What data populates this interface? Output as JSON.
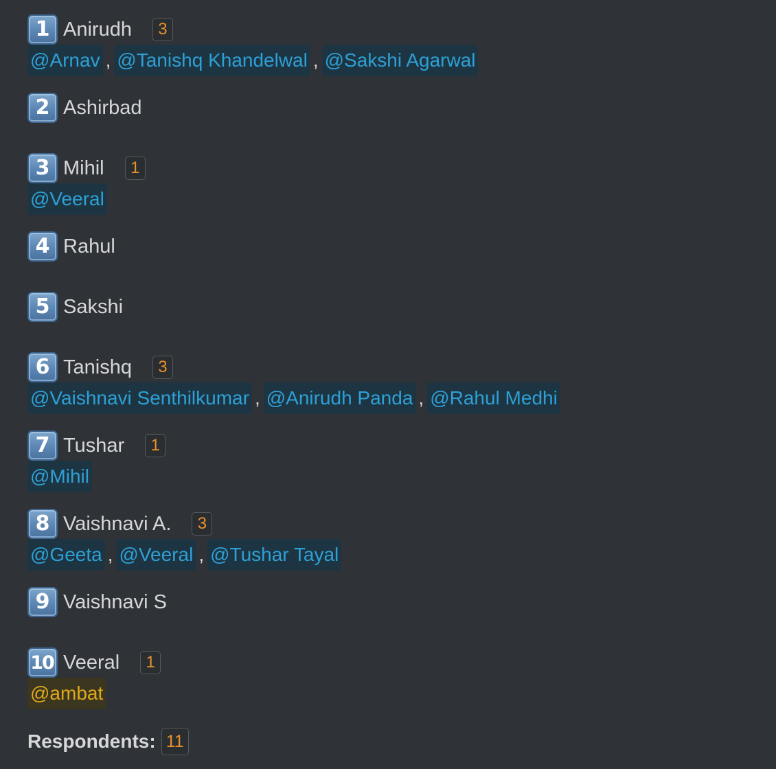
{
  "poll": {
    "options": [
      {
        "number": "1",
        "name": "Anirudh",
        "count": "3",
        "voters": [
          "@Arnav",
          "@Tanishq Khandelwal",
          "@Sakshi Agarwal"
        ]
      },
      {
        "number": "2",
        "name": "Ashirbad",
        "count": "",
        "voters": []
      },
      {
        "number": "3",
        "name": "Mihil",
        "count": "1",
        "voters": [
          "@Veeral"
        ]
      },
      {
        "number": "4",
        "name": "Rahul",
        "count": "",
        "voters": []
      },
      {
        "number": "5",
        "name": "Sakshi",
        "count": "",
        "voters": []
      },
      {
        "number": "6",
        "name": "Tanishq",
        "count": "3",
        "voters": [
          "@Vaishnavi Senthilkumar",
          "@Anirudh Panda",
          "@Rahul Medhi"
        ]
      },
      {
        "number": "7",
        "name": "Tushar",
        "count": "1",
        "voters": [
          "@Mihil"
        ]
      },
      {
        "number": "8",
        "name": "Vaishnavi A.",
        "count": "3",
        "voters": [
          "@Geeta",
          "@Veeral",
          "@Tushar Tayal"
        ]
      },
      {
        "number": "9",
        "name": "Vaishnavi S",
        "count": "",
        "voters": []
      },
      {
        "number": "10",
        "name": "Veeral",
        "count": "1",
        "voters": [
          "@ambat"
        ]
      }
    ],
    "respondents_label": "Respondents:",
    "respondents_count": "11"
  },
  "colors": {
    "background": "#2f3236",
    "text": "#d6d7d8",
    "count": "#e8912d",
    "mention_text": "#2ea0d6",
    "mention_background": "#1d3542",
    "self_mention_text": "#e0a91a",
    "self_mention_background": "#3b361f"
  },
  "icons": {
    "number_keycap": "keycap-digit-emoji"
  }
}
